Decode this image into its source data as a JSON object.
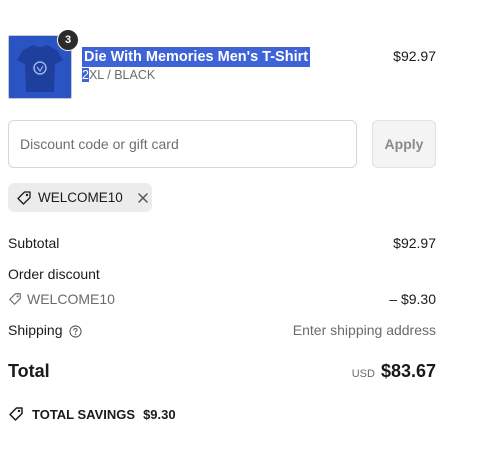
{
  "product": {
    "quantity": "3",
    "name": "Die With Memories Men's T-Shirt",
    "variant_highlight": "2",
    "variant_rest": "XL / BLACK",
    "price": "$92.97"
  },
  "discount": {
    "placeholder": "Discount code or gift card",
    "apply_label": "Apply",
    "applied_code": "WELCOME10"
  },
  "summary": {
    "subtotal_label": "Subtotal",
    "subtotal_value": "$92.97",
    "order_discount_label": "Order discount",
    "order_discount_code": "WELCOME10",
    "order_discount_value": "– $9.30",
    "shipping_label": "Shipping",
    "shipping_value": "Enter shipping address",
    "total_label": "Total",
    "currency": "USD",
    "total_value": "$83.67",
    "savings_label": "TOTAL SAVINGS",
    "savings_value": "$9.30"
  },
  "colors": {
    "selection": "#3d63d6",
    "product_thumb": "#2a54c4",
    "badge": "#2b2b2b"
  },
  "icons": [
    "tshirt-image",
    "tag-icon",
    "close-icon",
    "help-circle-icon"
  ]
}
